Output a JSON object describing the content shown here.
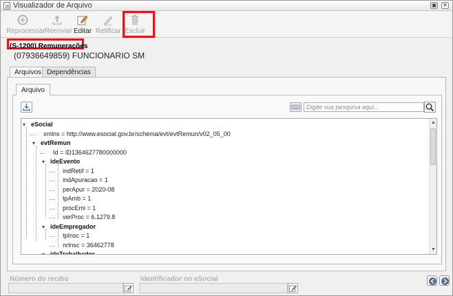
{
  "window": {
    "title": "Visualizador de Arquivo",
    "controls": [
      "restore-icon",
      "close-icon"
    ]
  },
  "toolbar": {
    "items": [
      {
        "label": "Reprocessar",
        "icon": "reprocess-icon",
        "enabled": false
      },
      {
        "label": "Reenviar",
        "icon": "upload-icon",
        "enabled": false
      },
      {
        "label": "Editar",
        "icon": "edit-icon",
        "enabled": true
      },
      {
        "label": "Retificar",
        "icon": "rectify-icon",
        "enabled": false
      },
      {
        "label": "Excluir",
        "icon": "trash-icon",
        "enabled": false
      }
    ]
  },
  "event": {
    "title": "(S-1200) Remunerações",
    "worker": "(07936649859) FUNCIONARIO SM"
  },
  "tabs": [
    {
      "label": "Arquivos",
      "active": true
    },
    {
      "label": "Dependências",
      "active": false
    }
  ],
  "file_panel": {
    "tab_label": "Arquivo",
    "search_placeholder": "Digite sua pesquisa aqui...",
    "download_icon": "download-icon",
    "keyboard_icon": "keyboard-icon",
    "search_icon": "search-icon"
  },
  "tree": {
    "rows": [
      {
        "text": "eSocial",
        "node": true,
        "expanded": true,
        "depth": 0
      },
      {
        "text": "xmlns = http://www.esocial.gov.br/schema/evt/evtRemun/v02_05_00",
        "node": false,
        "depth": 1
      },
      {
        "text": "evtRemun",
        "node": true,
        "expanded": true,
        "depth": 1
      },
      {
        "text": "Id = ID1364627780000000",
        "node": false,
        "depth": 2
      },
      {
        "text": "ideEvento",
        "node": true,
        "expanded": true,
        "depth": 2
      },
      {
        "text": "indRetif = 1",
        "node": false,
        "depth": 3
      },
      {
        "text": "indApuracao = 1",
        "node": false,
        "depth": 3
      },
      {
        "text": "perApur = 2020-08",
        "node": false,
        "depth": 3
      },
      {
        "text": "tpAmb = 1",
        "node": false,
        "depth": 3
      },
      {
        "text": "procEmi = 1",
        "node": false,
        "depth": 3
      },
      {
        "text": "verProc = 6.1279.8",
        "node": false,
        "depth": 3
      },
      {
        "text": "ideEmpregador",
        "node": true,
        "expanded": true,
        "depth": 2
      },
      {
        "text": "tpInsc = 1",
        "node": false,
        "depth": 3
      },
      {
        "text": "nrInsc = 36462778",
        "node": false,
        "depth": 3
      },
      {
        "text": "ideTrabalhador",
        "node": true,
        "expanded": true,
        "depth": 2
      }
    ]
  },
  "footer": {
    "receipt_label": "Número do recibo",
    "receipt_value": "",
    "esocial_id_label": "Identificador no eSocial",
    "esocial_id_value": "",
    "edit_icon": "edit-icon",
    "prev_icon": "arrow-left-icon",
    "next_icon": "arrow-right-icon"
  },
  "colors": {
    "highlight": "#e0141e",
    "disabled_text": "#a0a0a0"
  }
}
